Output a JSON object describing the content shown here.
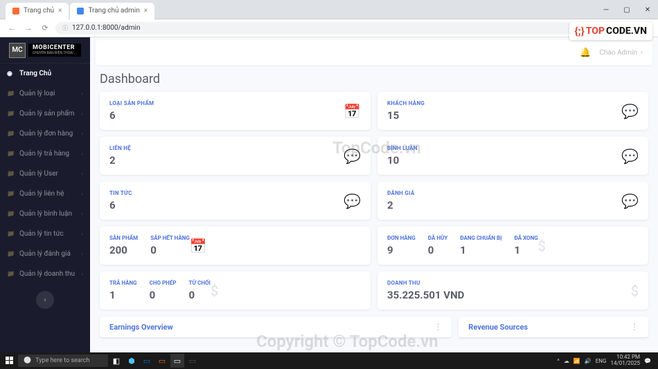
{
  "browser": {
    "tabs": [
      {
        "title": "Trang chủ",
        "favicon": "orange"
      },
      {
        "title": "Trang chủ admin",
        "favicon": "blue"
      }
    ],
    "url": "127.0.0.1:8000/admin"
  },
  "topcode_badge": {
    "brace": "{;}",
    "top": "TOP",
    "code": "CODE.VN"
  },
  "sidebar": {
    "logo_mc": "MC",
    "logo_brand": "MOBICENTER",
    "logo_sub": "CHUYÊN BÁN ĐIỆN THOẠI ...",
    "items": [
      {
        "label": "Trang Chủ",
        "icon": "dashboard",
        "active": true,
        "chev": false
      },
      {
        "label": "Quản lý loại",
        "icon": "folder"
      },
      {
        "label": "Quản lý sản phẩm",
        "icon": "folder"
      },
      {
        "label": "Quản lý đơn hàng",
        "icon": "folder"
      },
      {
        "label": "Quản lý trả hàng",
        "icon": "folder"
      },
      {
        "label": "Quản lý User",
        "icon": "folder"
      },
      {
        "label": "Quản lý liên hệ",
        "icon": "folder"
      },
      {
        "label": "Quản lý bình luận",
        "icon": "folder"
      },
      {
        "label": "Quản lý tin tức",
        "icon": "folder"
      },
      {
        "label": "Quản lý đánh giá",
        "icon": "folder"
      },
      {
        "label": "Quản lý doanh thu",
        "icon": "folder"
      }
    ]
  },
  "topbar": {
    "user": "Chào Admin"
  },
  "page": {
    "title": "Dashboard"
  },
  "rows": [
    [
      {
        "label": "LOẠI SẢN PHẨM",
        "value": "6",
        "icon": "calendar"
      },
      {
        "label": "KHÁCH HÀNG",
        "value": "15",
        "icon": "comments"
      }
    ],
    [
      {
        "label": "LIÊN HỆ",
        "value": "2",
        "icon": "comments"
      },
      {
        "label": "BÌNH LUẬN",
        "value": "10",
        "icon": "comments"
      }
    ],
    [
      {
        "label": "TIN TỨC",
        "value": "6",
        "icon": "comments"
      },
      {
        "label": "ĐÁNH GIÁ",
        "value": "2",
        "icon": "comments"
      }
    ],
    [
      {
        "multi": [
          {
            "label": "SẢN PHẨM",
            "value": "200"
          },
          {
            "label": "SẮP HẾT HÀNG",
            "value": "0"
          }
        ],
        "icon": "calendar"
      },
      {
        "multi": [
          {
            "label": "ĐƠN HÀNG",
            "value": "9"
          },
          {
            "label": "ĐÃ HỦY",
            "value": "0"
          },
          {
            "label": "ĐANG CHUẨN BỊ",
            "value": "1"
          },
          {
            "label": "ĐÃ XONG",
            "value": "1"
          }
        ],
        "icon": "dollar"
      }
    ],
    [
      {
        "multi": [
          {
            "label": "TRẢ HÀNG",
            "value": "1"
          },
          {
            "label": "CHO PHÉP",
            "value": "0"
          },
          {
            "label": "TỪ CHỐI",
            "value": "0"
          }
        ],
        "icon": "dollar"
      },
      {
        "label": "DOANH THU",
        "value": "35.225.501 VND",
        "icon": "dollar"
      }
    ]
  ],
  "panels": [
    {
      "title": "Earnings Overview"
    },
    {
      "title": "Revenue Sources"
    }
  ],
  "watermarks": {
    "w1": "TopCode.vn",
    "w2": "Copyright © TopCode.vn"
  },
  "taskbar": {
    "search": "Type here to search",
    "time": "10:42 PM",
    "date": "14/01/2025"
  }
}
